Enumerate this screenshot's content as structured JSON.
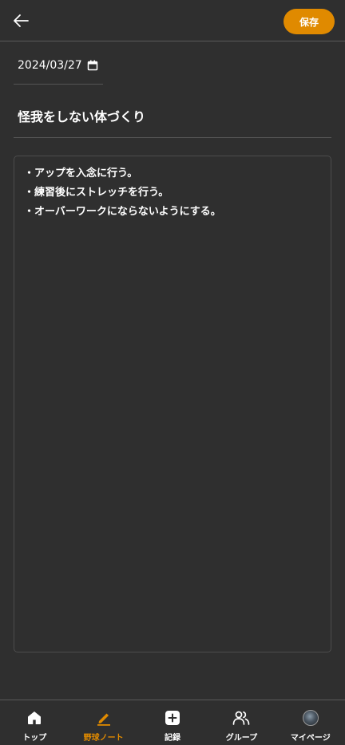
{
  "header": {
    "back_icon": "arrow-left-icon",
    "save_label": "保存"
  },
  "note": {
    "date": "2024/03/27",
    "calendar_icon": "calendar-icon",
    "title": "怪我をしない体づくり",
    "memo_lines": [
      "・アップを入念に行う。",
      "・練習後にストレッチを行う。",
      "・オーバーワークにならないようにする。"
    ]
  },
  "nav": {
    "items": [
      {
        "label": "トップ",
        "icon": "home-icon"
      },
      {
        "label": "野球ノート",
        "icon": "pencil-icon"
      },
      {
        "label": "記録",
        "icon": "plus-square-icon"
      },
      {
        "label": "グループ",
        "icon": "users-icon"
      },
      {
        "label": "マイページ",
        "icon": "avatar"
      }
    ],
    "active_index": 1
  },
  "colors": {
    "accent": "#e08a00",
    "background": "#2f2f2f",
    "divider": "#5a5a5a",
    "text": "#ffffff"
  }
}
